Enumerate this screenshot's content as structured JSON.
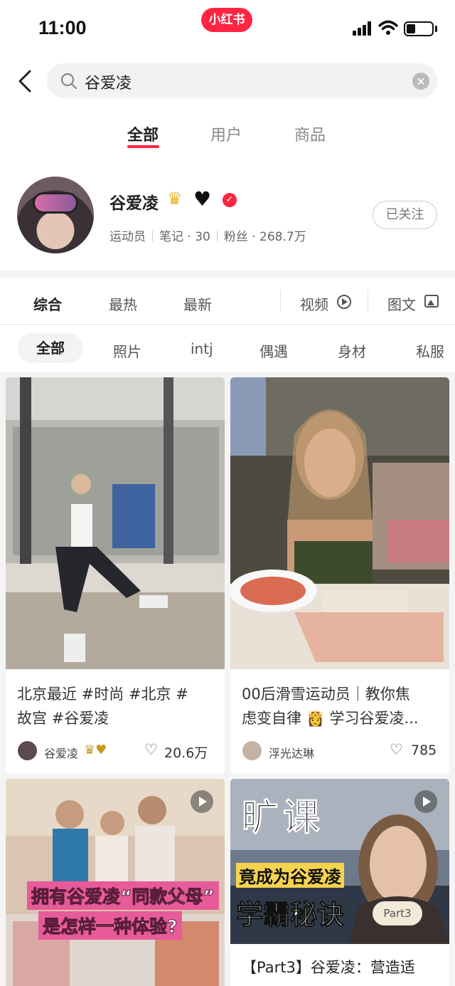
{
  "status_bar": {
    "time": "11:00",
    "app_badge": "小红书"
  },
  "search": {
    "query": "谷爱凌",
    "clear": "×"
  },
  "tabs": [
    {
      "label": "全部",
      "active": true
    },
    {
      "label": "用户",
      "active": false
    },
    {
      "label": "商品",
      "active": false
    }
  ],
  "profile": {
    "name": "谷爱凌",
    "crown": "♛",
    "heart": "♥",
    "verified": "✓",
    "role": "运动员",
    "notes": "笔记 · 30",
    "fans": "粉丝 · 268.7万",
    "follow_label": "已关注"
  },
  "sort_bar": {
    "items": [
      "综合",
      "最热",
      "最新"
    ],
    "video": "视频",
    "image_text": "图文"
  },
  "filters": [
    "全部",
    "照片",
    "intj",
    "偶遇",
    "身材",
    "私服"
  ],
  "cards": [
    {
      "title_line1": "北京最近 #时尚  #北京  #",
      "title_line2": "故宫  #谷爱凌",
      "author": "谷爱凌",
      "author_emoji": "♛♥",
      "likes": "20.6万",
      "like_icon": "♡"
    },
    {
      "title_line1": "00后滑雪运动员｜教你焦",
      "title_line2": "虑变自律 👸 学习谷爱凌...",
      "author": "浮光达琳",
      "likes": "785",
      "like_icon": "♡"
    },
    {
      "overlay_line1": "拥有谷爱凌“同款父母”",
      "overlay_line2": "是怎样一种体验?"
    },
    {
      "overlay_big": "旷课",
      "overlay_mid": "竟成为谷爱凌",
      "overlay_bottom": "学霸秘诀",
      "part_badge": "Part3",
      "title_line1": "【Part3】谷爱凌：营造适"
    }
  ],
  "colors": {
    "accent": "#ff2442"
  }
}
